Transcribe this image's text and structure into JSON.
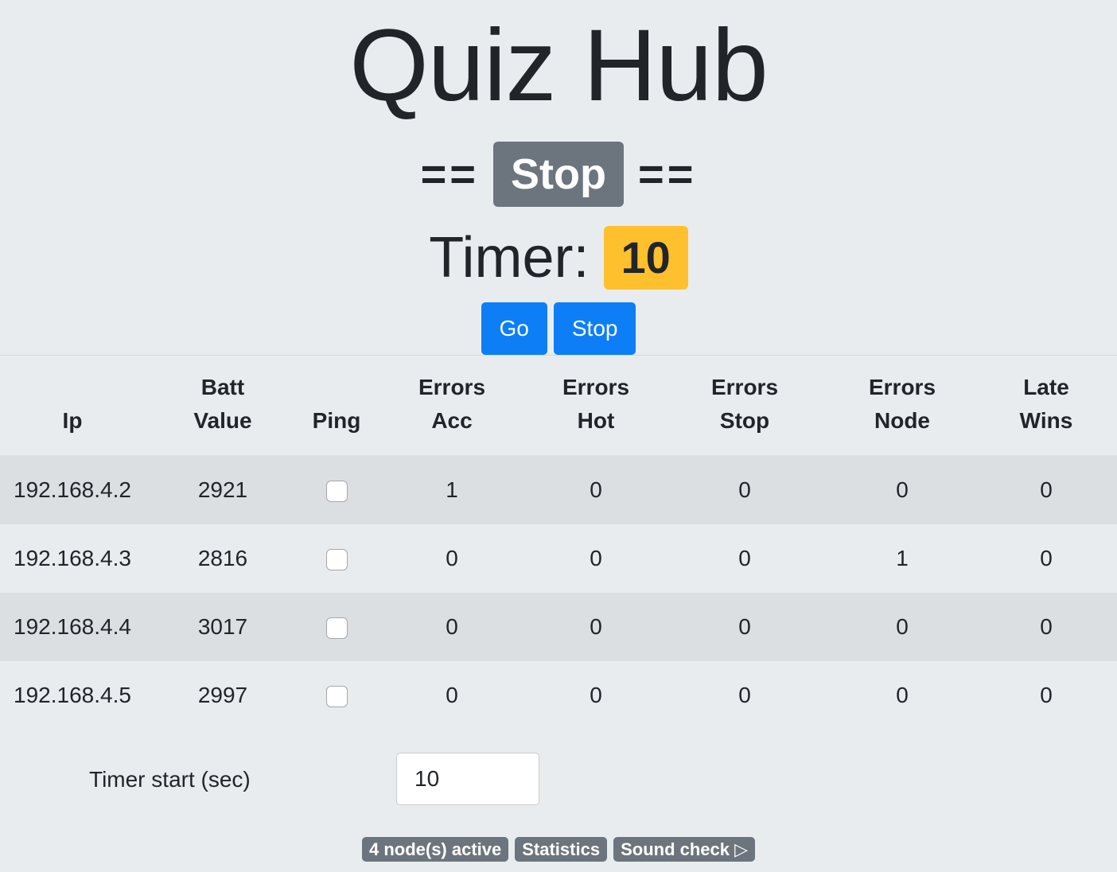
{
  "header": {
    "title": "Quiz Hub",
    "state_prefix": "==",
    "state_label": "Stop",
    "state_suffix": "==",
    "timer_label": "Timer:",
    "timer_value": "10"
  },
  "controls": {
    "go_label": "Go",
    "stop_label": "Stop"
  },
  "table": {
    "columns": [
      [
        "",
        "Ip"
      ],
      [
        "Batt",
        "Value"
      ],
      [
        "",
        "Ping"
      ],
      [
        "Errors",
        "Acc"
      ],
      [
        "Errors",
        "Hot"
      ],
      [
        "Errors",
        "Stop"
      ],
      [
        "Errors",
        "Node"
      ],
      [
        "Late",
        "Wins"
      ]
    ],
    "rows": [
      {
        "ip": "192.168.4.2",
        "batt": "2921",
        "ping": false,
        "acc": "1",
        "hot": "0",
        "stop": "0",
        "node": "0",
        "late": "0"
      },
      {
        "ip": "192.168.4.3",
        "batt": "2816",
        "ping": false,
        "acc": "0",
        "hot": "0",
        "stop": "0",
        "node": "1",
        "late": "0"
      },
      {
        "ip": "192.168.4.4",
        "batt": "3017",
        "ping": false,
        "acc": "0",
        "hot": "0",
        "stop": "0",
        "node": "0",
        "late": "0"
      },
      {
        "ip": "192.168.4.5",
        "batt": "2997",
        "ping": false,
        "acc": "0",
        "hot": "0",
        "stop": "0",
        "node": "0",
        "late": "0"
      }
    ]
  },
  "settings": {
    "timer_start_label": "Timer start (sec)",
    "timer_start_value": "10"
  },
  "footer": {
    "nodes_active": "4 node(s) active",
    "statistics": "Statistics",
    "sound_check": "Sound check ▷"
  },
  "colors": {
    "background": "#e9ecef",
    "state_badge": "#6c757d",
    "timer_badge": "#ffc02e",
    "primary_button": "#0d7ef5"
  }
}
